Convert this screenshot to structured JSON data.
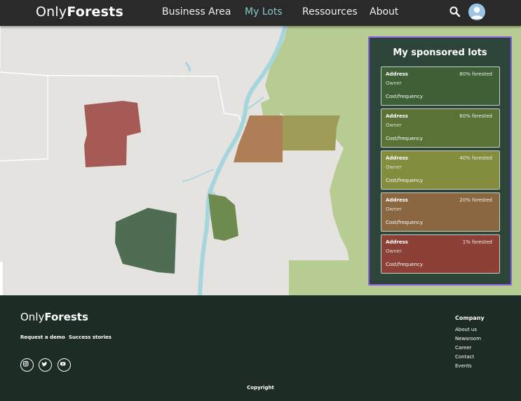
{
  "header": {
    "logo_light": "Only",
    "logo_bold": "Forests",
    "nav": {
      "business_area": "Business Area",
      "my_lots": "My Lots",
      "resources": "Ressources",
      "about": "About"
    },
    "active_color": "#89c4cf",
    "search_icon": "search-icon",
    "avatar_icon": "user-avatar-icon"
  },
  "map": {
    "land_color": "#e4e3e0",
    "forest_color": "#b6cc92",
    "water_color": "#a5d6dd",
    "lot_colors": {
      "red": "#a55a55",
      "green": "#4f6d52",
      "olive": "#6e8a4f",
      "orange": "#ae7f56",
      "yellow": "#9f9c58"
    }
  },
  "sponsored": {
    "title": "My sponsored lots",
    "lots": [
      {
        "address": "Address",
        "owner": "Owner",
        "cost": "Cost/frequency",
        "forested": "80% forested",
        "color": "#3f6036"
      },
      {
        "address": "Address",
        "owner": "Owner",
        "cost": "Cost/frequency",
        "forested": "60% forested",
        "color": "#5b7236"
      },
      {
        "address": "Address",
        "owner": "Owner",
        "cost": "Cost/frequency",
        "forested": "40% forested",
        "color": "#848c3d"
      },
      {
        "address": "Address",
        "owner": "Owner",
        "cost": "Cost/frequency",
        "forested": "20% forested",
        "color": "#8a6740"
      },
      {
        "address": "Address",
        "owner": "Owner",
        "cost": "Cost/frequency",
        "forested": "1% forested",
        "color": "#8d4035"
      }
    ],
    "highlight_color": "#8a5fe0"
  },
  "footer": {
    "logo_light": "Only",
    "logo_bold": "Forests",
    "links": [
      "Request a demo",
      "Success stories"
    ],
    "social_icons": [
      "instagram-icon",
      "twitter-icon",
      "youtube-icon"
    ],
    "company": {
      "title": "Company",
      "links": [
        "About us",
        "Newsroom",
        "Career",
        "Contact",
        "Events"
      ]
    },
    "copyright": "Copyright"
  }
}
